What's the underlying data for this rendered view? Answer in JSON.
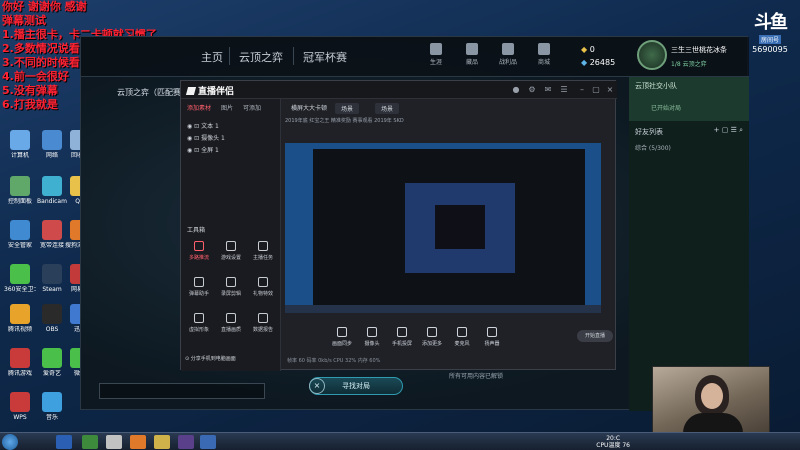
{
  "overlay_lines": [
    "你好 谢谢你 感谢",
    "弹幕测试",
    "1.播主很卡，卡二卡顿就习惯了",
    "2.多数情况说看不大",
    "3.不同的时候看看投影弹幕",
    "4.前一会很好",
    "5.没有弹幕",
    "6.打我就是"
  ],
  "desktop_icons": [
    {
      "label": "计算机",
      "color": "#6aa9e8"
    },
    {
      "label": "网络",
      "color": "#4a8ad0"
    },
    {
      "label": "回收站",
      "color": "#8fb2d8"
    },
    {
      "label": "控制面板",
      "color": "#5fa86a"
    },
    {
      "label": "Bandicam",
      "color": "#3fb0d0"
    },
    {
      "label": "QQ",
      "color": "#e8c14a"
    },
    {
      "label": "安全管家",
      "color": "#3f8ad0"
    },
    {
      "label": "宽带连接",
      "color": "#cf4a4a"
    },
    {
      "label": "搜狗浏览器",
      "color": "#e07a2a"
    },
    {
      "label": "360安全卫士",
      "color": "#4ac04a"
    },
    {
      "label": "Steam",
      "color": "#2a3f5a"
    },
    {
      "label": "腾讯视频",
      "color": "#e8a42a"
    },
    {
      "label": "OBS",
      "color": "#2a2a2a"
    },
    {
      "label": "腾讯游戏",
      "color": "#c93a3a"
    },
    {
      "label": "爱奇艺",
      "color": "#4ac04a"
    },
    {
      "label": "WPS",
      "color": "#c93a3a"
    },
    {
      "label": "音乐",
      "color": "#3fa0e0"
    },
    {
      "label": "网易云",
      "color": "#c23a3a"
    },
    {
      "label": "迅雷",
      "color": "#3f7ad0"
    },
    {
      "label": "微信",
      "color": "#4ac04a"
    }
  ],
  "game": {
    "nav_tabs": [
      "主页",
      "云顶之弈",
      "冠军杯赛"
    ],
    "nav_icons": [
      "生涯",
      "藏品",
      "战利品",
      "商城"
    ],
    "coins": "0",
    "blue_essence": "26485",
    "username": "三生三世桃花冰条",
    "user_sub": "1/8 云顶之弈",
    "mode_label": "云顶之弈（匹配赛）",
    "party_title": "云顶社交小队",
    "party_sub": "已开始对局",
    "friends_title": "好友列表",
    "friends_group": "综合 (5/300)",
    "find_match": "寻找对局",
    "footer_text": "所有可用内容已解锁"
  },
  "stream": {
    "app_name": "直播伴侣",
    "left_tabs": [
      "添加素材",
      "图片",
      "可添加"
    ],
    "sources": [
      "文本 1",
      "摄像头 1",
      "全屏 1"
    ],
    "toolbox_label": "工具箱",
    "tools": [
      "多路推流",
      "游戏设置",
      "主播任务",
      "弹幕助手",
      "录屏剪辑",
      "礼物特效",
      "虚拟形象",
      "直播画质",
      "数据报告"
    ],
    "mobile_question": "分享手机到电脑画面",
    "scenes": [
      "横屏大大卡顿",
      "场景",
      "场景"
    ],
    "sub_bar": "2019年底 红宝之王  精准奖励 赛事观看 2019年  SKD",
    "bottom_buttons": [
      "画面同步",
      "摄像头",
      "手机投屏",
      "添加更多",
      "麦克风",
      "扬声器"
    ],
    "go_live": "开始直播",
    "stats": "帧率 60  码率 0kb/s  CPU 32%  内存 60%"
  },
  "douyu": {
    "mark": "斗鱼",
    "room_label": "房间号",
    "room_id": "5690095"
  },
  "taskbar": {
    "time": "20:C",
    "date": "CPU温度 76"
  }
}
